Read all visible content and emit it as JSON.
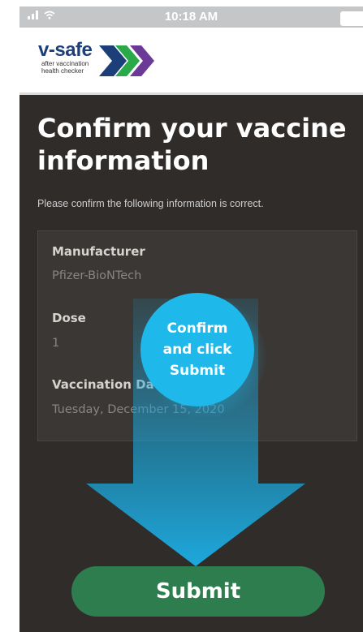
{
  "status_bar": {
    "signal_icon": "signal-bars-icon",
    "wifi_icon": "wifi-icon",
    "time": "10:18 AM",
    "battery_icon": "battery-icon"
  },
  "header": {
    "logo_name": "v-safe",
    "logo_subtitle_line1": "after vaccination",
    "logo_subtitle_line2": "health checker",
    "logo_arrows_icon": "chevron-arrows-icon"
  },
  "page": {
    "title": "Confirm your vaccine information",
    "subtitle": "Please confirm the following information is correct."
  },
  "vaccine_info": {
    "fields": [
      {
        "label": "Manufacturer",
        "value": "Pfizer-BioNTech"
      },
      {
        "label": "Dose",
        "value": "1"
      },
      {
        "label": "Vaccination Date",
        "value": "Tuesday, December 15, 2020"
      }
    ]
  },
  "callout": {
    "text_line1": "Confirm",
    "text_line2": "and click",
    "text_line3": "Submit"
  },
  "actions": {
    "submit_label": "Submit"
  },
  "colors": {
    "background": "#2f2c2a",
    "callout": "#1fb8ea",
    "arrow": "#1aa3d6",
    "submit": "#2e7d4e",
    "logo_blue": "#1c3f7a",
    "logo_green": "#2aa84a",
    "logo_purple": "#6a3a96"
  }
}
